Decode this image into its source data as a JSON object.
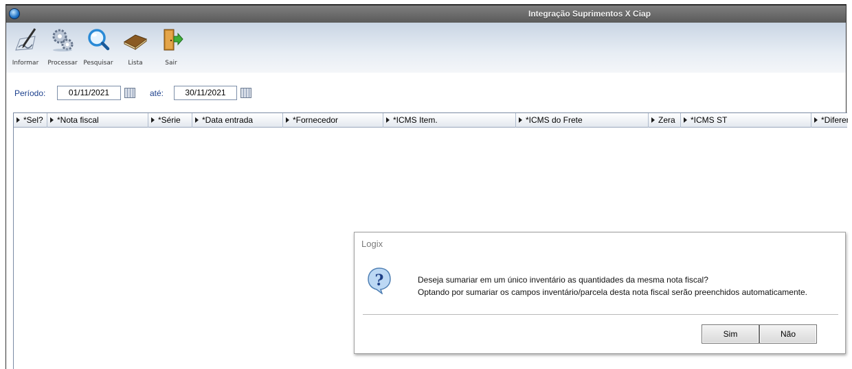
{
  "window": {
    "title": "Integração Suprimentos X Ciap"
  },
  "toolbar": {
    "informar": "Informar",
    "processar": "Processar",
    "pesquisar": "Pesquisar",
    "lista": "Lista",
    "sair": "Sair"
  },
  "filter": {
    "period_label": "Período:",
    "start_date": "01/11/2021",
    "until_label": "até:",
    "end_date": "30/11/2021"
  },
  "grid": {
    "columns": [
      "*Sel?",
      "*Nota fiscal",
      "*Série",
      "*Data entrada",
      "*Fornecedor",
      "*ICMS Item.",
      "*ICMS do Frete",
      "Zera",
      "*ICMS ST",
      "*Diferen"
    ]
  },
  "dialog": {
    "title": "Logix",
    "line1": "Deseja sumariar em um único inventário as quantidades da mesma nota fiscal?",
    "line2": "Optando por sumariar os campos inventário/parcela desta nota fiscal serão preenchidos automaticamente.",
    "yes": "Sim",
    "no": "Não"
  },
  "icons": {
    "app": "app-globe-icon",
    "informar": "pen-paper-icon",
    "processar": "gears-icon",
    "pesquisar": "magnifier-icon",
    "lista": "book-icon",
    "sair": "exit-door-icon",
    "calendar": "calendar-icon",
    "question": "question-icon"
  },
  "colors": {
    "title_bar": "#6b6b6b",
    "toolbar": "#d6e0ec",
    "label": "#1b3f8c"
  }
}
